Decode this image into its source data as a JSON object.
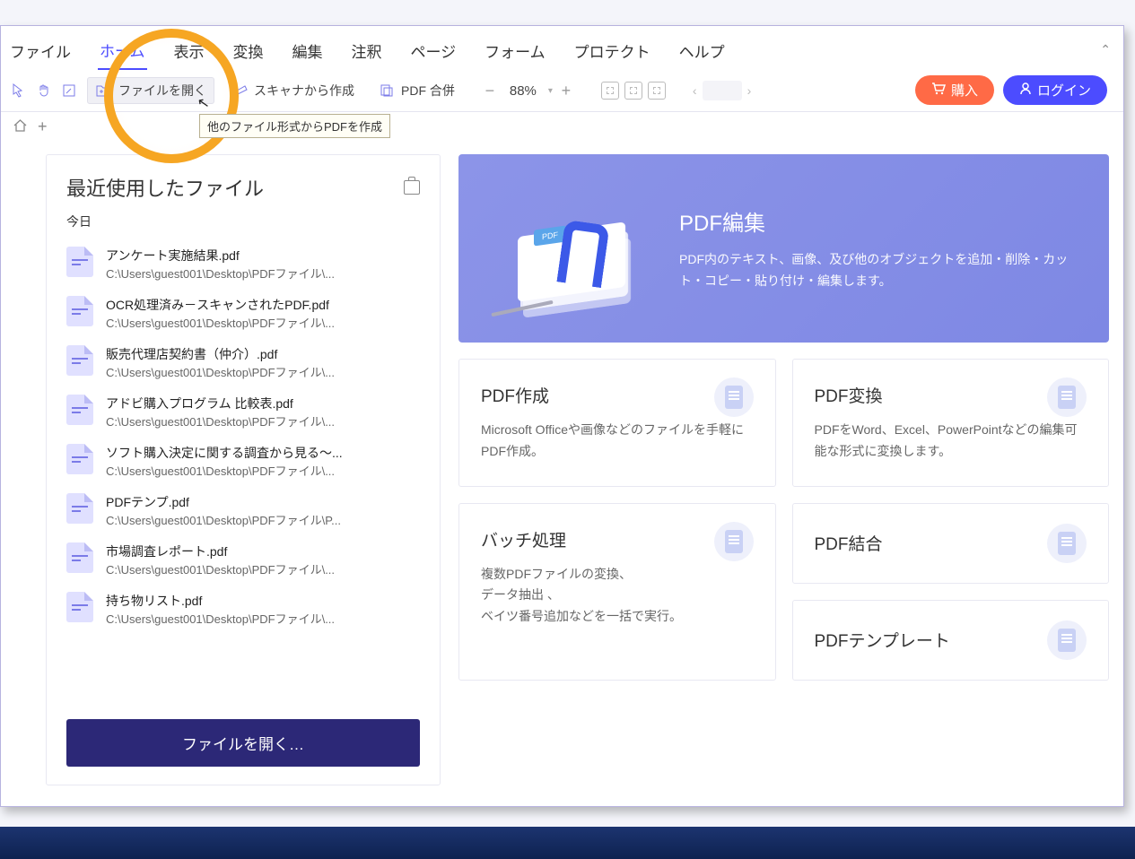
{
  "menu": {
    "file": "ファイル",
    "items": [
      "ホーム",
      "表示",
      "変換",
      "編集",
      "注釈",
      "ページ",
      "フォーム",
      "プロテクト",
      "ヘルプ"
    ],
    "active_index": 0
  },
  "toolbar": {
    "open_file": "ファイルを開く",
    "create_from_scanner": "スキャナから作成",
    "pdf_merge": "PDF 合併",
    "zoom": "88%",
    "buy": "購入",
    "login": "ログイン"
  },
  "tooltip": "他のファイル形式からPDFを作成",
  "recent": {
    "title": "最近使用したファイル",
    "today": "今日",
    "files": [
      {
        "name": "アンケート実施結果.pdf",
        "path": "C:\\Users\\guest001\\Desktop\\PDFファイル\\..."
      },
      {
        "name": "OCR処理済み－スキャンされたPDF.pdf",
        "path": "C:\\Users\\guest001\\Desktop\\PDFファイル\\..."
      },
      {
        "name": "販売代理店契約書（仲介）.pdf",
        "path": "C:\\Users\\guest001\\Desktop\\PDFファイル\\..."
      },
      {
        "name": "アドビ購入プログラム 比較表.pdf",
        "path": "C:\\Users\\guest001\\Desktop\\PDFファイル\\..."
      },
      {
        "name": "ソフト購入決定に関する調査から見る～...",
        "path": "C:\\Users\\guest001\\Desktop\\PDFファイル\\..."
      },
      {
        "name": "PDFテンプ.pdf",
        "path": "C:\\Users\\guest001\\Desktop\\PDFファイル\\P..."
      },
      {
        "name": "市場調査レポート.pdf",
        "path": "C:\\Users\\guest001\\Desktop\\PDFファイル\\..."
      },
      {
        "name": "持ち物リスト.pdf",
        "path": "C:\\Users\\guest001\\Desktop\\PDFファイル\\..."
      }
    ],
    "open_button": "ファイルを開く…"
  },
  "hero": {
    "title": "PDF編集",
    "desc": "PDF内のテキスト、画像、及び他のオブジェクトを追加・削除・カット・コピー・貼り付け・編集します。",
    "pdf_tag": "PDF"
  },
  "cards": {
    "create": {
      "title": "PDF作成",
      "desc": "Microsoft Officeや画像などのファイルを手軽にPDF作成。"
    },
    "convert": {
      "title": "PDF変換",
      "desc": "PDFをWord、Excel、PowerPointなどの編集可能な形式に変換します。"
    },
    "batch": {
      "title": "バッチ処理",
      "desc": "複数PDFファイルの変換、\nデータ抽出 、\nベイツ番号追加などを一括で実行。"
    },
    "combine": {
      "title": "PDF結合"
    },
    "template": {
      "title": "PDFテンプレート"
    }
  }
}
